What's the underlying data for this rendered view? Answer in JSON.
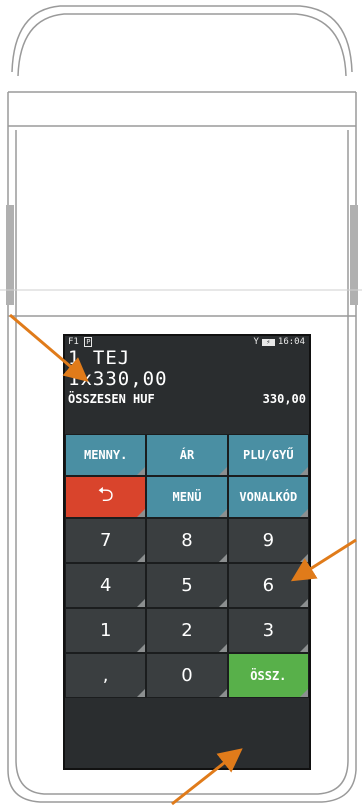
{
  "status": {
    "left": "F1",
    "printer_badge": "P",
    "battery_symbol": "⚡",
    "time": "16:04"
  },
  "receipt": {
    "item": "1 TEJ",
    "qty_price": "1x330,00",
    "total_label": "ÖSSZESEN HUF",
    "total_value": "330,00"
  },
  "keys": {
    "qty": "MENNY.",
    "price": "ÁR",
    "plu": "PLU/GYŰ",
    "back": "⮌",
    "menu": "MENÜ",
    "barcode": "VONALKÓD",
    "n7": "7",
    "n8": "8",
    "n9": "9",
    "n4": "4",
    "n5": "5",
    "n6": "6",
    "n1": "1",
    "n2": "2",
    "n3": "3",
    "comma": ",",
    "n0": "0",
    "sum": "ÖSSZ."
  },
  "colors": {
    "function_key": "#4a8fa3",
    "back_key": "#d9442c",
    "number_key": "#3a3e40",
    "sum_key": "#58b04a",
    "arrows": "#e07b1a"
  }
}
